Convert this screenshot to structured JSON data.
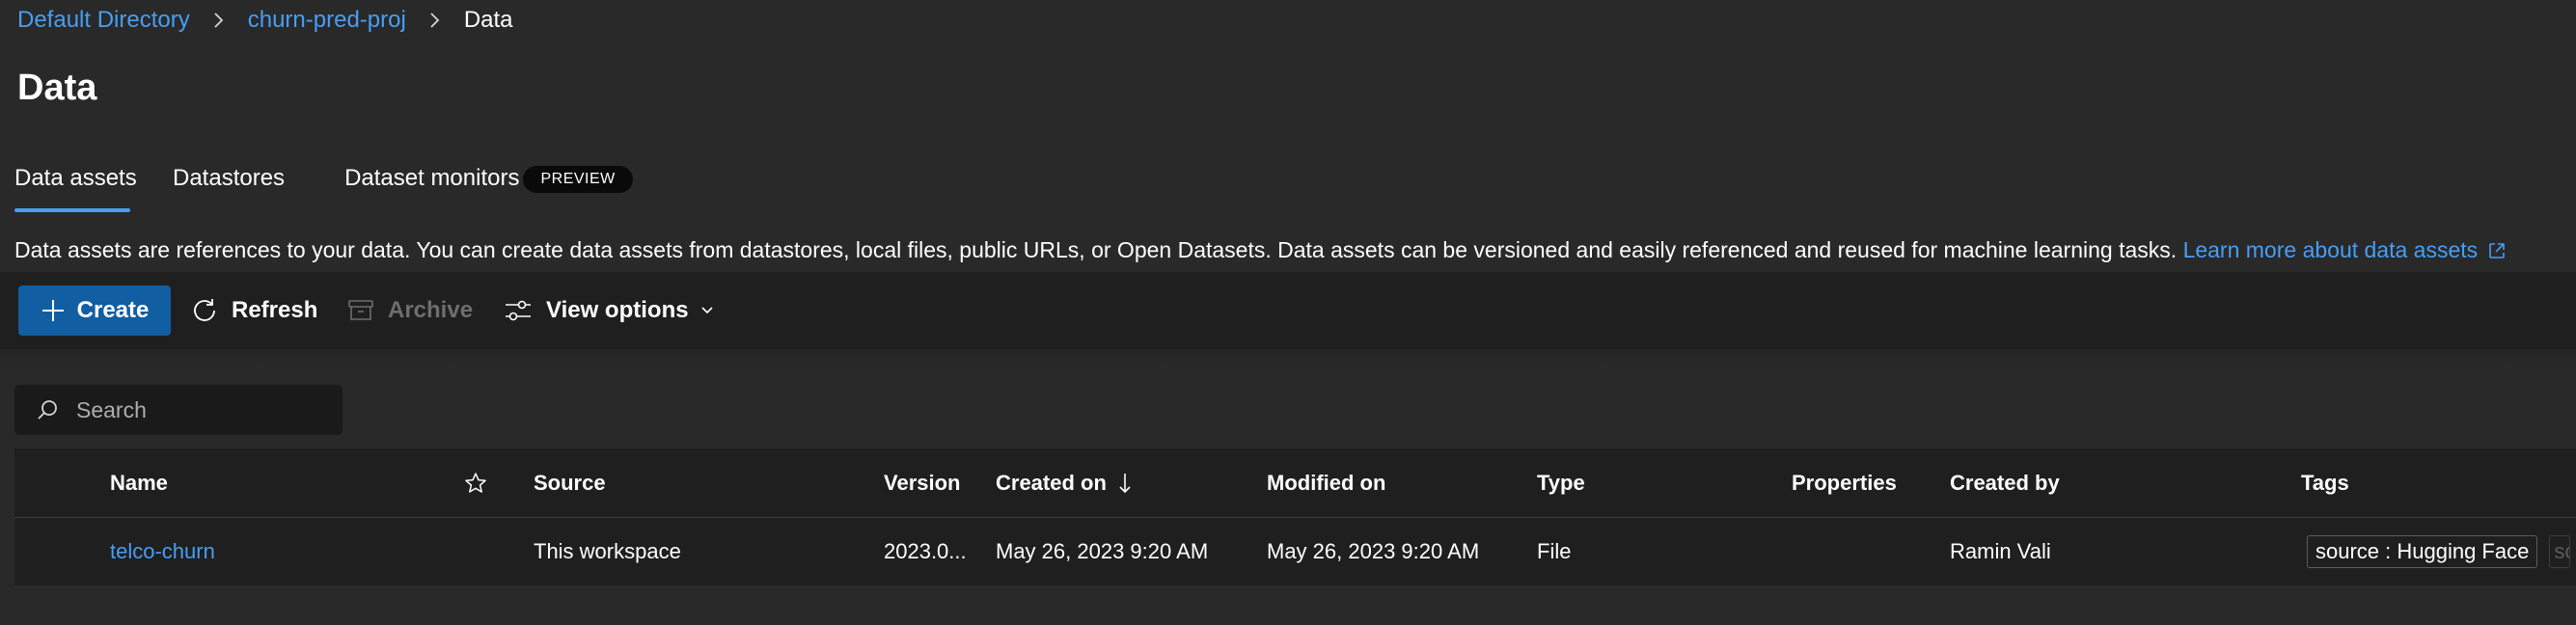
{
  "breadcrumb": {
    "items": [
      {
        "label": "Default Directory"
      },
      {
        "label": "churn-pred-proj"
      },
      {
        "label": "Data"
      }
    ]
  },
  "page": {
    "title": "Data"
  },
  "tabs": [
    {
      "label": "Data assets",
      "active": true
    },
    {
      "label": "Datastores",
      "active": false
    },
    {
      "label": "Dataset monitors",
      "active": false,
      "badge": "PREVIEW"
    }
  ],
  "description": {
    "text": "Data assets are references to your data. You can create data assets from datastores, local files, public URLs, or Open Datasets. Data assets can be versioned and easily referenced and reused for machine learning tasks.",
    "link_label": "Learn more about data assets"
  },
  "toolbar": {
    "create_label": "Create",
    "refresh_label": "Refresh",
    "archive_label": "Archive",
    "view_options_label": "View options"
  },
  "search": {
    "placeholder": "Search",
    "value": ""
  },
  "table": {
    "columns": {
      "name": "Name",
      "source": "Source",
      "version": "Version",
      "created_on": "Created on",
      "modified_on": "Modified on",
      "type": "Type",
      "properties": "Properties",
      "created_by": "Created by",
      "tags": "Tags"
    },
    "sort": {
      "column": "created_on",
      "direction": "descending"
    },
    "rows": [
      {
        "name": "telco-churn",
        "source": "This workspace",
        "version": "2023.0...",
        "created_on": "May 26, 2023 9:20 AM",
        "modified_on": "May 26, 2023 9:20 AM",
        "type": "File",
        "properties": "",
        "created_by": "Ramin Vali",
        "tags": [
          "source : Hugging Face",
          "sc"
        ]
      }
    ]
  },
  "icons": {
    "breadcrumb_separator": "chevron-right-icon",
    "create": "plus-icon",
    "refresh": "refresh-icon",
    "archive": "archive-icon",
    "view_options": "sliders-icon",
    "search": "search-icon",
    "favorite": "star-outline-icon",
    "external_link": "external-link-icon"
  },
  "colors": {
    "background": "#292929",
    "toolbar_background": "#1f1f1f",
    "link": "#479ef5",
    "primary_button": "#115ea3",
    "disabled_text": "#6e6e6e"
  }
}
